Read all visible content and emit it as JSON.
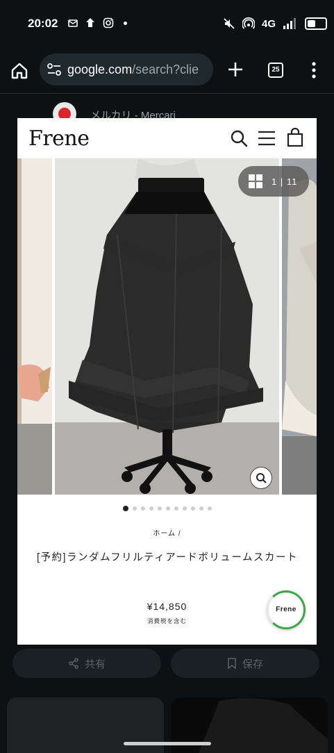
{
  "status_bar": {
    "time": "20:02",
    "network": "4G"
  },
  "toolbar": {
    "url_domain": "google.com",
    "url_path": "/search?clie",
    "tab_count": "25"
  },
  "background_result": {
    "source_name": "メルカリ - Mercari"
  },
  "store": {
    "logo": "Frene",
    "image_counter": "1 | 11",
    "breadcrumb": "ホーム /",
    "product_title": "[予約]ランダムフリルティアードボリュームスカート",
    "price": "¥14,850",
    "tax_note": "消費税を含む",
    "chat_badge": "Frene",
    "carousel_total": 11,
    "carousel_active": 1
  },
  "actions": {
    "share_label": "共有",
    "save_label": "保存"
  },
  "colors": {
    "page_bg": "#0d1114",
    "url_bar_bg": "#1e2a2e",
    "card_bg": "#ffffff",
    "chat_ring": "#3ea64a"
  }
}
